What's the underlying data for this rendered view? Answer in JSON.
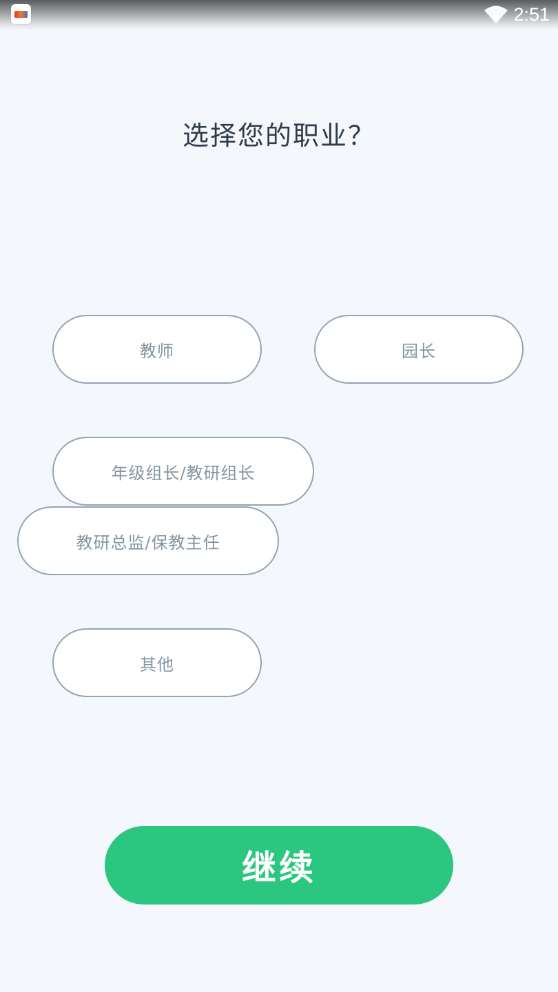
{
  "status_bar": {
    "time": "2:51",
    "icons": [
      "app-icon",
      "wifi-icon"
    ]
  },
  "header": {
    "title": "选择您的职业？"
  },
  "options": [
    {
      "label": "教师"
    },
    {
      "label": "园长"
    },
    {
      "label": "年级组长/教研组长"
    },
    {
      "label": "教研总监/保教主任"
    },
    {
      "label": "其他"
    }
  ],
  "footer": {
    "continue_label": "继续"
  },
  "colors": {
    "background": "#f4f8fd",
    "option_border": "#93a4b2",
    "option_text": "#8494a3",
    "accent": "#2bc67f",
    "title_text": "#2f3b4a"
  }
}
